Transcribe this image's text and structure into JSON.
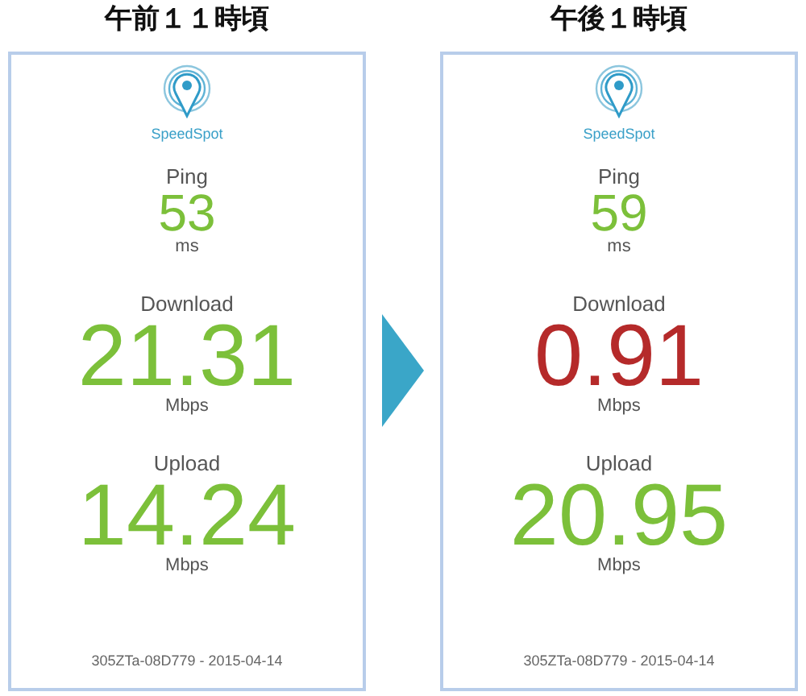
{
  "panels": [
    {
      "title": "午前１１時頃",
      "app_name": "SpeedSpot",
      "metrics": [
        {
          "label": "Ping",
          "value": "53",
          "unit": "ms",
          "kind": "small",
          "color": "#7cc03a"
        },
        {
          "label": "Download",
          "value": "21.31",
          "unit": "Mbps",
          "kind": "large",
          "color": "#7cc03a"
        },
        {
          "label": "Upload",
          "value": "14.24",
          "unit": "Mbps",
          "kind": "large",
          "color": "#7cc03a"
        }
      ],
      "footer": "305ZTa-08D779 - 2015-04-14"
    },
    {
      "title": "午後１時頃",
      "app_name": "SpeedSpot",
      "metrics": [
        {
          "label": "Ping",
          "value": "59",
          "unit": "ms",
          "kind": "small",
          "color": "#7cc03a"
        },
        {
          "label": "Download",
          "value": "0.91",
          "unit": "Mbps",
          "kind": "large",
          "color": "#b52a2a"
        },
        {
          "label": "Upload",
          "value": "20.95",
          "unit": "Mbps",
          "kind": "large",
          "color": "#7cc03a"
        }
      ],
      "footer": "305ZTa-08D779 - 2015-04-14"
    }
  ]
}
